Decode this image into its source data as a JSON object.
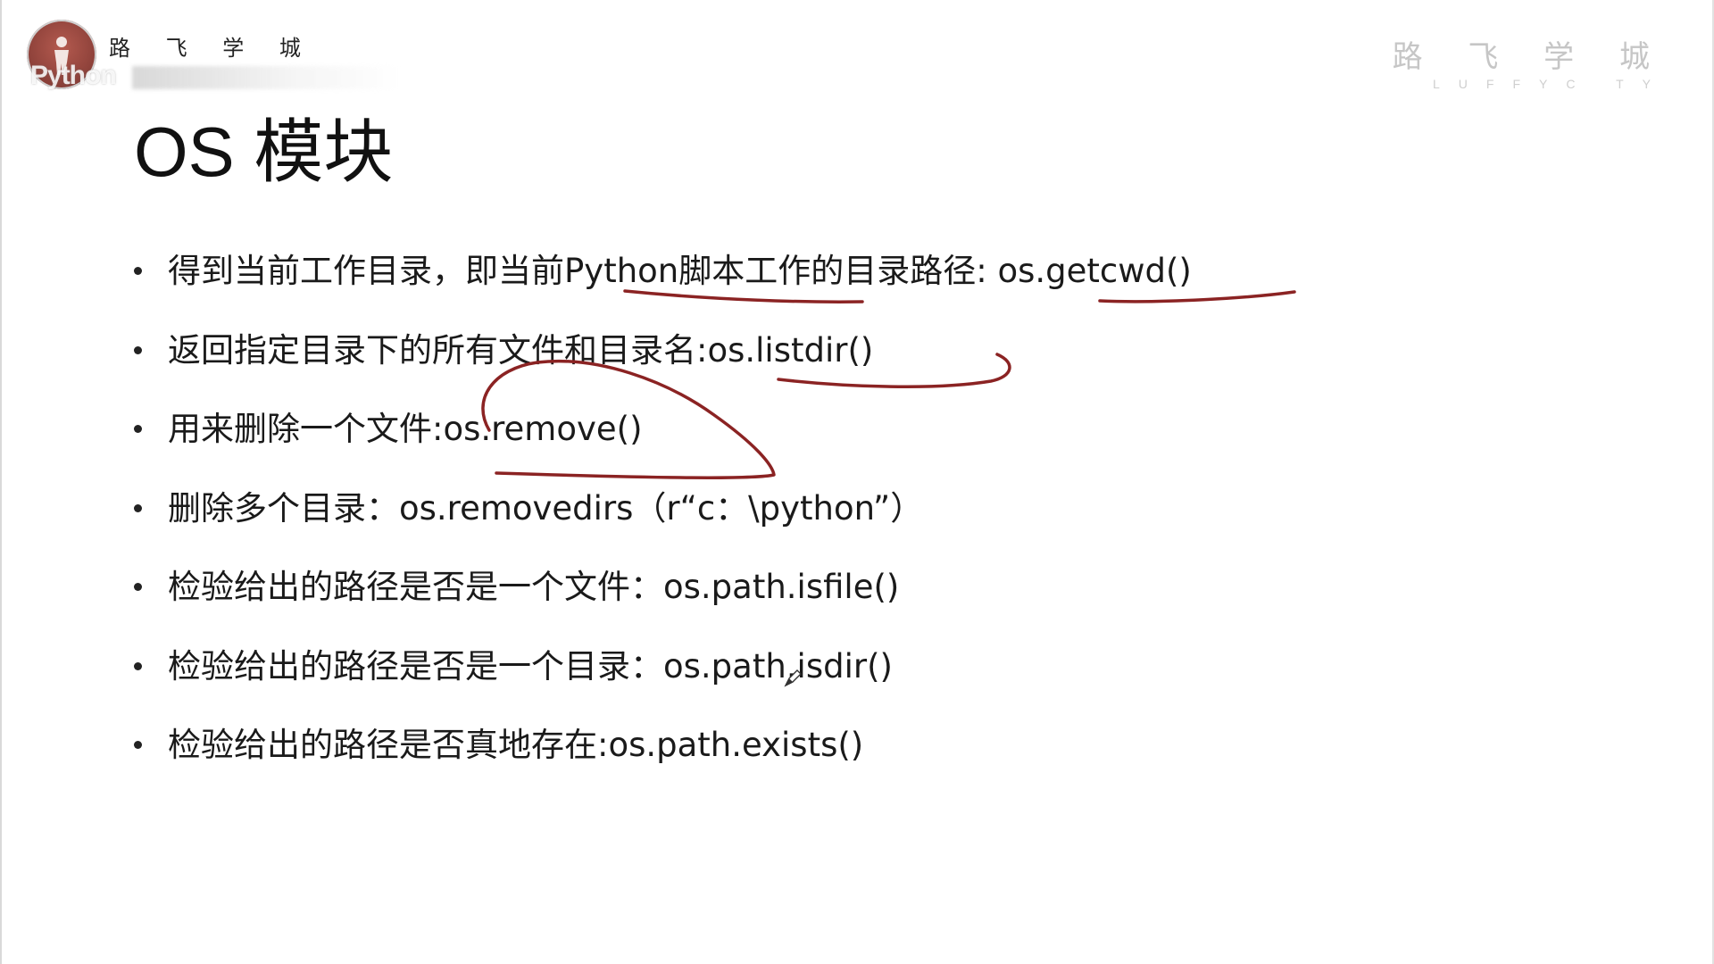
{
  "logo_left": {
    "cn_text": "路 飞 学 城",
    "overlay_text": "Python"
  },
  "logo_right": {
    "cn_text": "路 飞 学 城",
    "en_text": "LUFFYC TY"
  },
  "title": "OS 模块",
  "bullets": [
    {
      "text": "得到当前工作目录，即当前Python脚本工作的目录路径: os.getcwd()"
    },
    {
      "text": "返回指定目录下的所有文件和目录名:os.listdir()"
    },
    {
      "text": "用来删除一个文件:os.remove()"
    },
    {
      "text": "删除多个目录：os.removedirs（r“c：\\python”）"
    },
    {
      "text": "检验给出的路径是否是一个文件：os.path.isfile()"
    },
    {
      "text": "检验给出的路径是否是一个目录：os.path.isdir()"
    },
    {
      "text": "检验给出的路径是否真地存在:os.path.exists()"
    }
  ],
  "colors": {
    "annotation_ink": "#8b2323",
    "text": "#1a1a1a",
    "watermark": "#c6c6c6"
  },
  "icons": {
    "logo_badge": "runner-person-icon",
    "cursor": "pen-cursor-icon"
  }
}
